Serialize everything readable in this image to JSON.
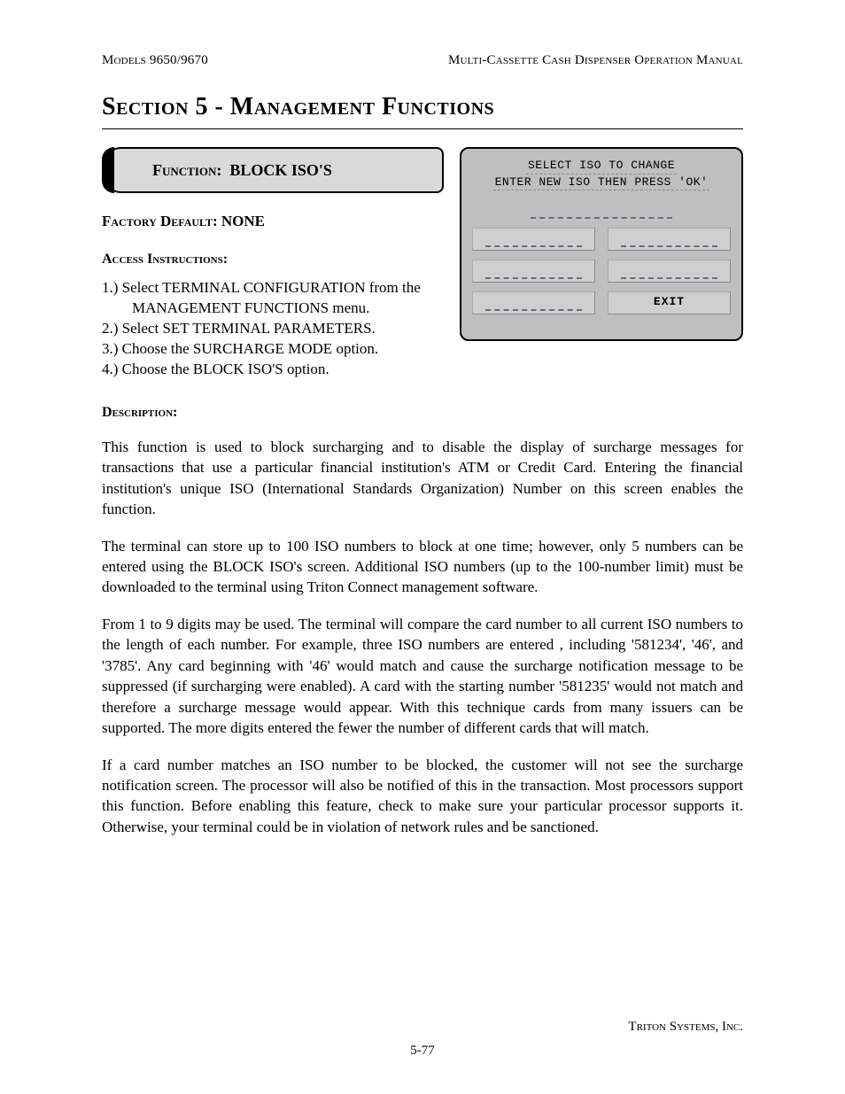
{
  "header": {
    "left": "Models 9650/9670",
    "right": "Multi-Cassette Cash Dispenser Operation Manual"
  },
  "section_title": "Section 5 - Management Functions",
  "function_box": {
    "label": "Function:",
    "name": "BLOCK ISO'S"
  },
  "screen": {
    "line1": "SELECT ISO TO CHANGE",
    "line2": "ENTER NEW ISO THEN PRESS 'OK'",
    "exit_label": "EXIT"
  },
  "factory_default": {
    "label": "Factory Default:",
    "value": "NONE"
  },
  "access_instructions_label": "Access Instructions:",
  "steps": [
    "1.) Select TERMINAL CONFIGURATION from the MANAGEMENT FUNCTIONS menu.",
    "2.) Select SET TERMINAL PARAMETERS.",
    "3.) Choose the SURCHARGE MODE option.",
    "4.) Choose the BLOCK ISO'S option."
  ],
  "description_label": "Description:",
  "paragraphs": [
    "This function is used to block surcharging and to disable the display of surcharge messages for transactions that use a particular financial institution's ATM or Credit Card.  Entering the financial institution's unique ISO (International Standards Organization) Number on this screen enables the function.",
    "The terminal can store up to 100 ISO numbers to block at one time; however, only 5 numbers can be entered using the BLOCK ISO's screen. Additional ISO numbers (up to the 100-number limit) must be downloaded to the terminal using Triton Connect management software.",
    "From 1 to 9 digits may be used.  The terminal will compare the card number to all current ISO numbers to the length of each number.  For example, three ISO numbers are entered , including '581234', '46', and '3785'.  Any card beginning with '46' would match and cause the surcharge notification message to be suppressed (if surcharging were enabled).  A card with the starting number '581235' would not match and therefore a surcharge message would appear.  With this technique cards from many issuers can be supported.  The more digits entered the fewer the number of different cards that will match.",
    "If a card number matches an ISO number to be blocked, the customer will not see the surcharge notification screen.  The processor will also be notified of this in the transaction.  Most processors support this function.  Before enabling this feature, check to make sure your particular processor supports it.  Otherwise, your terminal could be in violation of network rules and be sanctioned."
  ],
  "footer": {
    "company": "Triton Systems, Inc.",
    "page_number": "5-77"
  }
}
